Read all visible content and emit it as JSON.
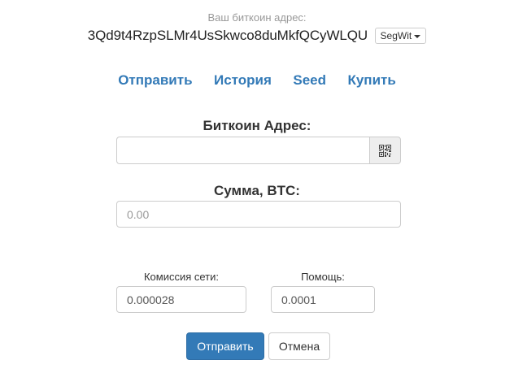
{
  "header": {
    "address_label": "Ваш биткоин адрес:",
    "address_value": "3Qd9t4RzpSLMr4UsSkwco8duMkfQCyWLQU",
    "address_type": "SegWit"
  },
  "nav": {
    "items": [
      {
        "label": "Отправить"
      },
      {
        "label": "История"
      },
      {
        "label": "Seed"
      },
      {
        "label": "Купить"
      }
    ]
  },
  "form": {
    "address_label": "Биткоин Адрес:",
    "address_value": "",
    "amount_label": "Сумма, BTC:",
    "amount_placeholder": "0.00",
    "fee_label": "Комиссия сети:",
    "fee_value": "0.000028",
    "help_label": "Помощь:",
    "help_value": "0.0001"
  },
  "actions": {
    "send_label": "Отправить",
    "cancel_label": "Отмена"
  },
  "icons": {
    "scan": "qr-code-icon",
    "dropdown": "caret-down-icon"
  },
  "colors": {
    "accent": "#337ab7",
    "muted": "#999999"
  }
}
